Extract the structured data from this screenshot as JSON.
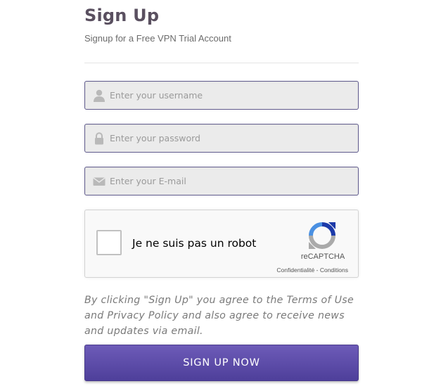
{
  "header": {
    "title": "Sign Up",
    "subtitle": "Signup for a Free VPN Trial Account"
  },
  "form": {
    "username": {
      "placeholder": "Enter your username",
      "value": "",
      "icon": "user-icon"
    },
    "password": {
      "placeholder": "Enter your password",
      "value": "",
      "icon": "lock-icon"
    },
    "email": {
      "placeholder": "Enter your E-mail",
      "value": "",
      "icon": "envelope-icon"
    }
  },
  "captcha": {
    "label": "Je ne suis pas un robot",
    "brand": "reCAPTCHA",
    "privacy": "Confidentialité",
    "separator": " - ",
    "terms": "Conditions",
    "icon": "recaptcha-logo-icon"
  },
  "agreement": "By clicking \"Sign Up\" you agree to the Terms of Use and Privacy Policy and also agree to receive news and updates via email.",
  "submit": {
    "label": "SIGN UP NOW"
  },
  "colors": {
    "accent": "#5a4aa8",
    "field_border": "#5f5a8c",
    "field_bg": "#ebebeb",
    "title": "#5a5060"
  }
}
